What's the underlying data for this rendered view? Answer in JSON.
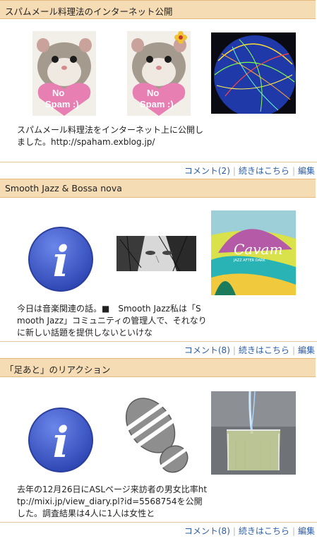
{
  "entries": [
    {
      "title": "スパムメール料理法のインターネット公開",
      "excerpt": "スパムメール料理法をインターネット上に公開しました。http://spaham.exblog.jp/",
      "images": [
        {
          "icon": "hamster-no-spam-heart-icon",
          "heart_text_1": "No",
          "heart_text_2": "Spam :)"
        },
        {
          "icon": "hamster-no-spam-heart-flower-icon",
          "heart_text_1": "No",
          "heart_text_2": "Spam :)"
        },
        {
          "icon": "globe-network-icon"
        }
      ],
      "footer": {
        "comments": "コメント(2)",
        "more": "続きはこちら",
        "edit": "編集"
      }
    },
    {
      "title": "Smooth Jazz & Bossa nova",
      "excerpt": "今日は音楽関連の話。■　Smooth Jazz私は「Smooth Jazz」コミュニティの管理人で、それなりに新しい話題を提供しないといけな",
      "images": [
        {
          "icon": "info-icon",
          "glyph": "i"
        },
        {
          "icon": "face-eyes-photo-icon"
        },
        {
          "icon": "album-cover-icon",
          "cover_text": "Cavam",
          "cover_subtext": "JAZZ AFTER DARK"
        }
      ],
      "footer": {
        "comments": "コメント(8)",
        "more": "続きはこちら",
        "edit": "編集"
      }
    },
    {
      "title": "「足あと」のリアクション",
      "excerpt": "去年の12月26日にASLページ来訪者の男女比率http://mixi.jp/view_diary.pl?id=5568754を公開した。調査結果は4人に1人は女性と",
      "images": [
        {
          "icon": "info-icon",
          "glyph": "i"
        },
        {
          "icon": "shoe-print-icon"
        },
        {
          "icon": "beaker-flame-icon"
        }
      ],
      "footer": {
        "comments": "コメント(8)",
        "more": "続きはこちら",
        "edit": "編集"
      }
    }
  ],
  "colors": {
    "header_bg": "#f6dcb4",
    "link": "#2b5ca9",
    "info_blue": "#3d57c7"
  }
}
